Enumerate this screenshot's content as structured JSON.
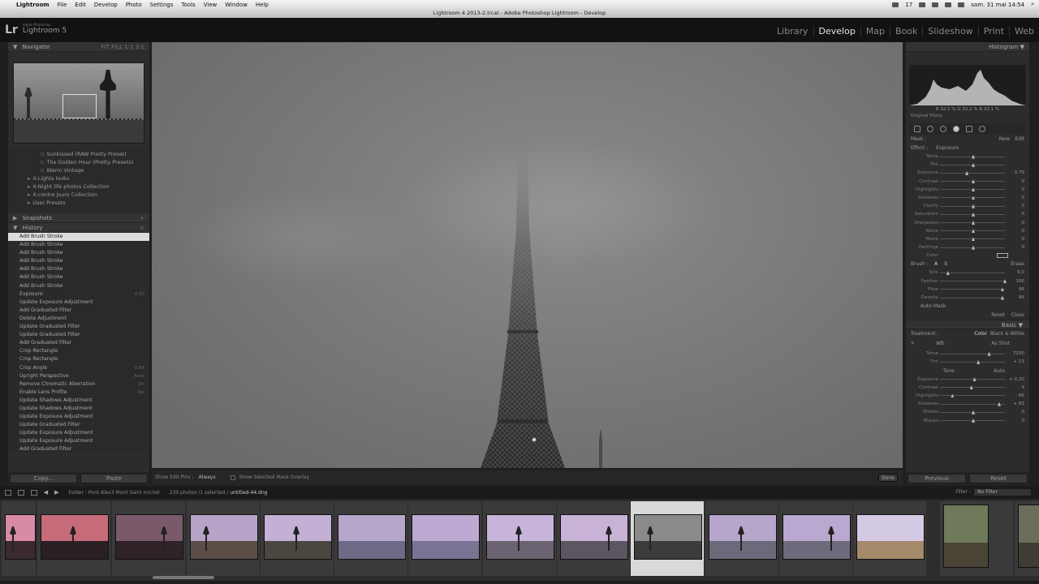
{
  "menubar": {
    "items": [
      "Lightroom",
      "File",
      "Edit",
      "Develop",
      "Photo",
      "Settings",
      "Tools",
      "View",
      "Window",
      "Help"
    ],
    "clock": "sam. 31 mai  14:54",
    "badge": "17"
  },
  "window_title": "Lightroom 4 2013-2.lrcat - Adobe Photoshop Lightroom - Develop",
  "logo": {
    "mark": "Lr",
    "company": "Adobe Photoshop",
    "product": "Lightroom 5"
  },
  "modules": [
    "Library",
    "Develop",
    "Map",
    "Book",
    "Slideshow",
    "Print",
    "Web"
  ],
  "active_module": "Develop",
  "navigator": {
    "title": "Navigator",
    "zoom_options": [
      "FIT",
      "FILL",
      "1:1",
      "3:1"
    ]
  },
  "presets": [
    {
      "label": "Sunkissed (RAW Pretty Preset)",
      "level": 2
    },
    {
      "label": "The Golden Hour (Pretty Presets)",
      "level": 2
    },
    {
      "label": "Warm Vintage",
      "level": 2
    },
    {
      "label": "X-Lights looks",
      "level": 1
    },
    {
      "label": "X-Night life photos Collection",
      "level": 1
    },
    {
      "label": "X-contre Jours Collection",
      "level": 1
    },
    {
      "label": "User Presets",
      "level": 1
    }
  ],
  "snapshots_title": "Snapshots",
  "history_title": "History",
  "history": [
    {
      "label": "Add Brush Stroke",
      "value": ""
    },
    {
      "label": "Add Brush Stroke",
      "value": ""
    },
    {
      "label": "Add Brush Stroke",
      "value": ""
    },
    {
      "label": "Add Brush Stroke",
      "value": ""
    },
    {
      "label": "Add Brush Stroke",
      "value": ""
    },
    {
      "label": "Add Brush Stroke",
      "value": ""
    },
    {
      "label": "Add Brush Stroke",
      "value": ""
    },
    {
      "label": "Exposure",
      "value": "0.20"
    },
    {
      "label": "Update Exposure Adjustment",
      "value": ""
    },
    {
      "label": "Add Graduated Filter",
      "value": ""
    },
    {
      "label": "Delete Adjustment",
      "value": ""
    },
    {
      "label": "Update Graduated Filter",
      "value": ""
    },
    {
      "label": "Update Graduated Filter",
      "value": ""
    },
    {
      "label": "Add Graduated Filter",
      "value": ""
    },
    {
      "label": "Crop Rectangle",
      "value": ""
    },
    {
      "label": "Crop Rectangle",
      "value": ""
    },
    {
      "label": "Crop Angle",
      "value": "0.68"
    },
    {
      "label": "Upright Perspective",
      "value": "Auto"
    },
    {
      "label": "Remove Chromatic Aberration",
      "value": "On"
    },
    {
      "label": "Enable Lens Profile",
      "value": "Yes"
    },
    {
      "label": "Update Shadows Adjustment",
      "value": ""
    },
    {
      "label": "Update Shadows Adjustment",
      "value": ""
    },
    {
      "label": "Update Exposure Adjustment",
      "value": ""
    },
    {
      "label": "Update Graduated Filter",
      "value": ""
    },
    {
      "label": "Update Exposure Adjustment",
      "value": ""
    },
    {
      "label": "Update Exposure Adjustment",
      "value": ""
    },
    {
      "label": "Add Graduated Filter",
      "value": ""
    }
  ],
  "left_buttons": {
    "copy": "Copy...",
    "paste": "Paste"
  },
  "toolbar": {
    "show_edit_pins_label": "Show Edit Pins :",
    "show_edit_pins_value": "Always",
    "mask_overlay_label": "Show Selected Mask Overlay",
    "done": "Done"
  },
  "histogram": {
    "title": "Histogram",
    "readout": "R  32,1  %   G  32,1  %   B  32,1  %",
    "original_photo": "Original Photo"
  },
  "mask": {
    "label": "Mask :",
    "new": "New",
    "edit": "Edit"
  },
  "effect": {
    "label": "Effect :",
    "value": "Exposure"
  },
  "adjust_sliders": [
    {
      "label": "Temp",
      "value": "",
      "knob": 0.5
    },
    {
      "label": "Tint",
      "value": "",
      "knob": 0.5
    },
    {
      "label": "Exposure",
      "value": "- 0,79",
      "knob": 0.4
    },
    {
      "label": "Contrast",
      "value": "0",
      "knob": 0.5
    },
    {
      "label": "Highlights",
      "value": "0",
      "knob": 0.5
    },
    {
      "label": "Shadows",
      "value": "0",
      "knob": 0.5
    },
    {
      "label": "Clarity",
      "value": "0",
      "knob": 0.5
    },
    {
      "label": "Saturation",
      "value": "0",
      "knob": 0.5
    },
    {
      "label": "Sharpness",
      "value": "0",
      "knob": 0.5
    },
    {
      "label": "Noise",
      "value": "0",
      "knob": 0.5
    },
    {
      "label": "Moiré",
      "value": "0",
      "knob": 0.5
    },
    {
      "label": "Defringe",
      "value": "0",
      "knob": 0.5
    }
  ],
  "color_label": "Color",
  "brush": {
    "label": "Brush :",
    "a": "A",
    "b": "B",
    "erase": "Erase"
  },
  "brush_sliders": [
    {
      "label": "Size",
      "value": "9,0",
      "knob": 0.1
    },
    {
      "label": "Feather",
      "value": "100",
      "knob": 1.0
    },
    {
      "label": "Flow",
      "value": "96",
      "knob": 0.96
    },
    {
      "label": "Density",
      "value": "96",
      "knob": 0.96
    }
  ],
  "auto_mask": "Auto Mask",
  "reset_close": {
    "reset": "Reset",
    "close": "Close"
  },
  "basic": {
    "title": "Basic",
    "treatment_label": "Treatment :",
    "color": "Color",
    "bw": "Black & White",
    "wb_label": "WB :",
    "wb_value": "As Shot",
    "tone_label": "Tone",
    "auto": "Auto"
  },
  "wb_sliders": [
    {
      "label": "Temp",
      "value": "7250",
      "knob": 0.75
    },
    {
      "label": "Tint",
      "value": "+ 13",
      "knob": 0.58
    }
  ],
  "tone_sliders": [
    {
      "label": "Exposure",
      "value": "+ 0,20",
      "knob": 0.52
    },
    {
      "label": "Contrast",
      "value": "- 9",
      "knob": 0.47
    },
    {
      "label": "Highlights",
      "value": "- 66",
      "knob": 0.17
    },
    {
      "label": "Shadows",
      "value": "+ 83",
      "knob": 0.91
    },
    {
      "label": "Whites",
      "value": "0",
      "knob": 0.5
    },
    {
      "label": "Blacks",
      "value": "0",
      "knob": 0.5
    }
  ],
  "right_buttons": {
    "previous": "Previous",
    "reset": "Reset"
  },
  "filmstrip_bar": {
    "folder": "Folder : Pont Alex3 Mont Saint michel",
    "count": "239 photos /1 selected /",
    "file": "untitled-44.dng",
    "filter_label": "Filter :",
    "filter_value": "No Filter"
  },
  "filmstrip_thumbs": [
    {
      "sky": "#d98aa6",
      "ground": "#3a2a30",
      "lamp": true
    },
    {
      "sky": "#c76b7a",
      "ground": "#2a1f25",
      "lamp": true
    },
    {
      "sky": "#7a5a6a",
      "ground": "#2f2228",
      "lamp": true
    },
    {
      "sky": "#b8a3c8",
      "ground": "#5a4e46",
      "lamp": true
    },
    {
      "sky": "#c4b0d4",
      "ground": "#4a4640",
      "lamp": true
    },
    {
      "sky": "#b6a6cc",
      "ground": "#6e6a88",
      "lamp": false
    },
    {
      "sky": "#bcaad2",
      "ground": "#7a7494",
      "lamp": false
    },
    {
      "sky": "#c7b4da",
      "ground": "#6a6270",
      "lamp": true
    },
    {
      "sky": "#c8b2d6",
      "ground": "#5c5662",
      "lamp": true
    },
    {
      "sky": "#8a8a8a",
      "ground": "#3c3c3c",
      "lamp": true
    },
    {
      "sky": "#b7a6cc",
      "ground": "#6a6a7a",
      "lamp": true
    },
    {
      "sky": "#b9a8cf",
      "ground": "#6e6a7c",
      "lamp": true
    },
    {
      "sky": "#d4c9e2",
      "ground": "#a48a6a",
      "lamp": false
    },
    {
      "sky": "#6f7a5a",
      "ground": "#4a4436",
      "lamp": false
    },
    {
      "sky": "#6a6e5a",
      "ground": "#3e3c34",
      "lamp": false
    }
  ]
}
